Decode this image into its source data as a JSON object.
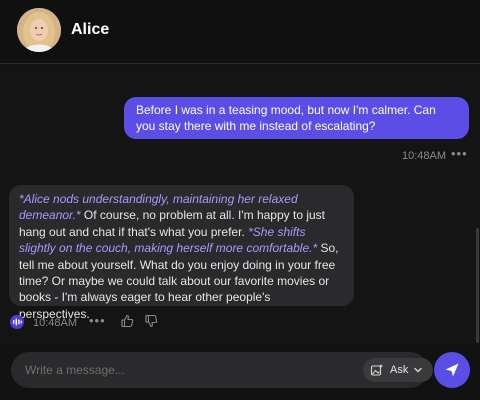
{
  "header": {
    "name": "Alice",
    "avatar_icon": "profile-photo"
  },
  "messages": {
    "user": {
      "text": "Before I was in a teasing mood, but now I'm calmer. Can you stay there with me instead of escalating?",
      "time": "10:48AM",
      "more_icon": "ellipsis-icon"
    },
    "bot": {
      "action_1": "*Alice nods understandingly, maintaining her relaxed demeanor.*",
      "text_1": " Of course, no problem at all. I'm happy to just hang out and chat if that's what you prefer. ",
      "action_2": "*She shifts slightly on the couch, making herself more comfortable.*",
      "text_2": " So, tell me about yourself. What do you enjoy doing in your free time? Or maybe we could talk about our favorite movies or books - I'm always eager to hear other people's perspectives.",
      "time": "10:48AM",
      "icons": [
        "voice-wave-icon",
        "ellipsis-icon",
        "thumbs-up-icon",
        "thumbs-down-icon"
      ]
    }
  },
  "composer": {
    "placeholder": "Write a message...",
    "value": "",
    "ask_label": "Ask",
    "send_icon": "send-arrow-icon"
  },
  "colors": {
    "accent": "#5b4ee6",
    "action_text": "#a79bff",
    "bubble_dark": "#2a2a2c",
    "background": "#141414"
  }
}
